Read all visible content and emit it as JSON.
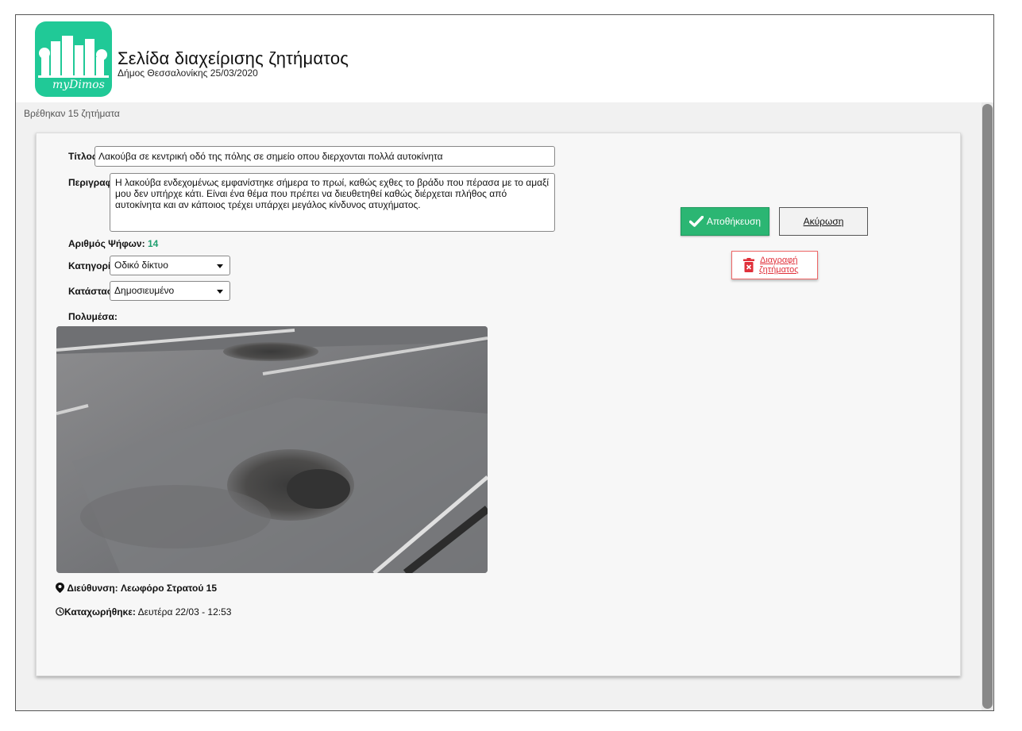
{
  "header": {
    "logo_text": "myDimos",
    "title": "Σελίδα διαχείρισης ζητήματος",
    "subtitle": "Δήμος Θεσσαλονίκης 25/03/2020"
  },
  "results": {
    "found_text": "Βρέθηκαν 15 ζητήματα"
  },
  "issue": {
    "title_label": "Τίτλος:",
    "title_value": "Λακούβα σε κεντρική οδό της πόλης σε σημείο οπου διερχονται πολλά αυτοκίνητα",
    "description_label": "Περιγραφή:",
    "description_value": "Η λακούβα ενδεχομένως εμφανίστηκε σήμερα το πρωί, καθώς εχθες το βράδυ που πέρασα με το αμαξί μου δεν υπήρχε κάτι. Είναι ένα θέμα που πρέπει να διευθετηθεί καθώς διέρχεται πλήθος από αυτοκίνητα και αν κάποιος τρέχει υπάρχει μεγάλος κίνδυνος ατυχήματος.",
    "votes_label": "Αριθμός Ψήφων:",
    "votes_value": "14",
    "category_label": "Κατηγορία:",
    "category_value": "Οδικό δίκτυο",
    "status_label": "Κατάσταση:",
    "status_value": "Δημοσιευμένο",
    "media_label": "Πολυμέσα:",
    "address_label": "Διεύθυνση:",
    "address_value": "Λεωφόρο Στρατού 15",
    "registered_label": "Καταχωρήθηκε:",
    "registered_value": "Δευτέρα 22/03 - 12:53"
  },
  "actions": {
    "save_label": "Αποθήκευση",
    "cancel_label": "Ακύρωση",
    "delete_label_line1": "Διαγραφή",
    "delete_label_line2": "ζητήματος"
  },
  "colors": {
    "brand": "#20c997",
    "save": "#2bb673",
    "delete": "#e0303a",
    "votes": "#20a070"
  },
  "icons": [
    "checkmark-icon",
    "trash-icon",
    "map-pin-icon",
    "clock-icon",
    "chevron-down-icon"
  ]
}
